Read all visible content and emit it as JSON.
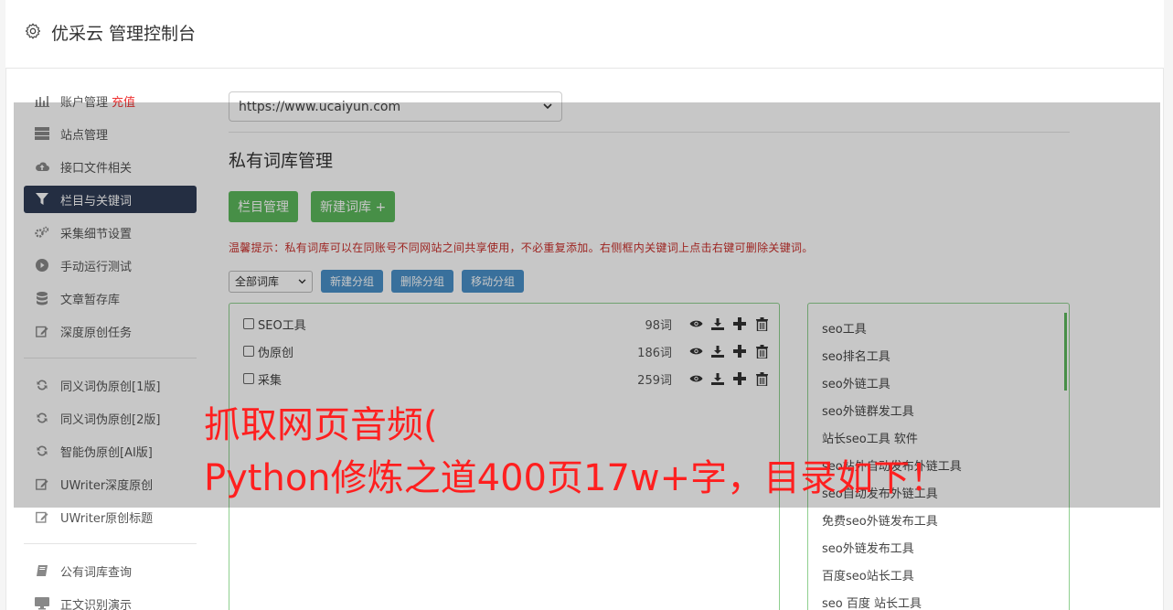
{
  "header": {
    "title": "优采云 管理控制台"
  },
  "sidebar": {
    "items": [
      {
        "icon": "bar-chart-icon",
        "label": "账户管理",
        "extra": "充值"
      },
      {
        "icon": "server-icon",
        "label": "站点管理"
      },
      {
        "icon": "cloud-upload-icon",
        "label": "接口文件相关"
      },
      {
        "icon": "filter-icon",
        "label": "栏目与关键词",
        "active": true
      },
      {
        "icon": "gears-icon",
        "label": "采集细节设置"
      },
      {
        "icon": "play-circle-icon",
        "label": "手动运行测试"
      },
      {
        "icon": "database-icon",
        "label": "文章暂存库"
      },
      {
        "icon": "edit-icon",
        "label": "深度原创任务"
      }
    ],
    "items2": [
      {
        "icon": "refresh-icon",
        "label": "同义词伪原创[1版]"
      },
      {
        "icon": "refresh-icon",
        "label": "同义词伪原创[2版]"
      },
      {
        "icon": "refresh-icon",
        "label": "智能伪原创[AI版]"
      },
      {
        "icon": "edit-icon",
        "label": "UWriter深度原创"
      },
      {
        "icon": "edit-icon",
        "label": "UWriter原创标题"
      }
    ],
    "items3": [
      {
        "icon": "book-icon",
        "label": "公有词库查询"
      },
      {
        "icon": "monitor-icon",
        "label": "正文识别演示"
      }
    ]
  },
  "main": {
    "site_select": "https://www.ucaiyun.com",
    "section_title": "私有词库管理",
    "btn_column": "栏目管理",
    "btn_new_lib": "新建词库 +",
    "tip": "温馨提示：私有词库可以在同账号不同网站之间共享使用，不必重复添加。右侧框内关键词上点击右键可删除关键词。",
    "group_select": "全部词库",
    "btn_new_group": "新建分组",
    "btn_delete_group": "删除分组",
    "btn_move_group": "移动分组"
  },
  "libraries": [
    {
      "name": "SEO工具",
      "count": "98词"
    },
    {
      "name": "伪原创",
      "count": "186词"
    },
    {
      "name": "采集",
      "count": "259词"
    }
  ],
  "keywords": [
    "seo工具",
    "seo排名工具",
    "seo外链工具",
    "seo外链群发工具",
    "站长seo工具 软件",
    "seo站外自动发布外链工具",
    "seo自动发布外链工具",
    "免费seo外链发布工具",
    "seo外链发布工具",
    "百度seo站长工具",
    "seo 百度 站长工具"
  ],
  "overlay": {
    "line1": "抓取网页音频(",
    "line2": "Python修炼之道400页17w+字，目录如下！"
  },
  "colors": {
    "active_nav": "#2f3c55",
    "green": "#5cb85c",
    "blue_btn": "#4a90c8",
    "tip_red": "#c9302c",
    "overlay_text": "#ff1f1f"
  }
}
